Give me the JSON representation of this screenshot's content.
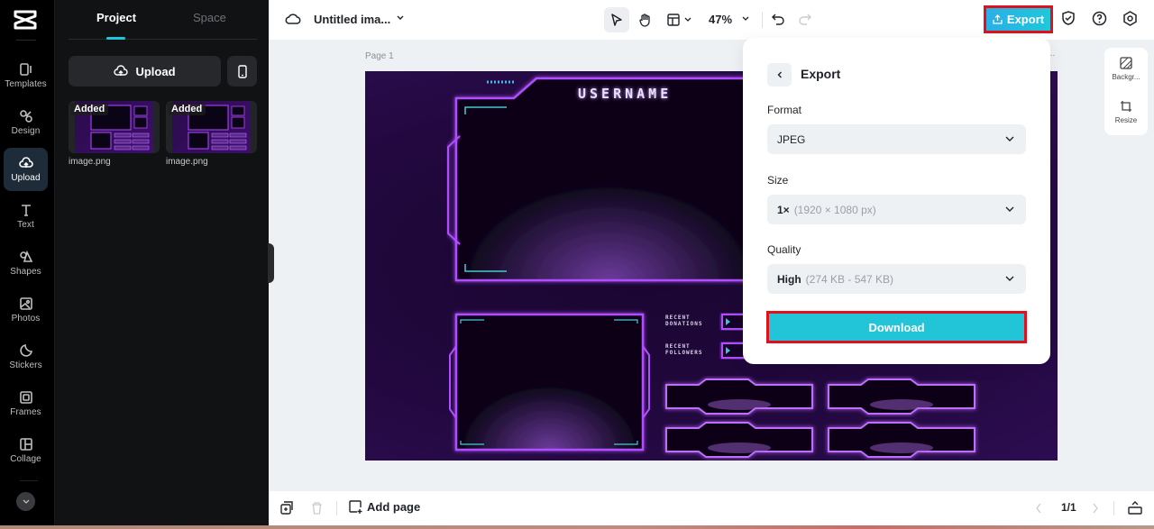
{
  "rail": {
    "items": [
      {
        "label": "Templates",
        "icon": "templates-icon"
      },
      {
        "label": "Design",
        "icon": "design-icon"
      },
      {
        "label": "Upload",
        "icon": "cloud-upload-icon",
        "active": true
      },
      {
        "label": "Text",
        "icon": "text-icon"
      },
      {
        "label": "Shapes",
        "icon": "shapes-icon"
      },
      {
        "label": "Photos",
        "icon": "photo-icon"
      },
      {
        "label": "Stickers",
        "icon": "sticker-icon"
      },
      {
        "label": "Frames",
        "icon": "frame-icon"
      },
      {
        "label": "Collage",
        "icon": "collage-icon"
      }
    ]
  },
  "panel": {
    "tabs": [
      {
        "label": "Project",
        "active": true
      },
      {
        "label": "Space",
        "active": false
      }
    ],
    "upload_label": "Upload",
    "files": [
      {
        "badge": "Added",
        "name": "image.png"
      },
      {
        "badge": "Added",
        "name": "image.png"
      }
    ]
  },
  "topbar": {
    "title": "Untitled ima...",
    "zoom": "47%",
    "export_label": "Export"
  },
  "canvas": {
    "page_label": "Page 1",
    "page_more": "...",
    "artwork": {
      "username": "USERNAME",
      "recent_donations": [
        "RECENT",
        "DONATIONS"
      ],
      "recent_followers": [
        "RECENT",
        "FOLLOWERS"
      ]
    }
  },
  "side_tools": [
    {
      "label": "Backgr...",
      "icon": "background-icon"
    },
    {
      "label": "Resize",
      "icon": "resize-icon"
    }
  ],
  "export_panel": {
    "title": "Export",
    "format": {
      "label": "Format",
      "value": "JPEG"
    },
    "size": {
      "label": "Size",
      "value": "1×",
      "detail": "(1920 × 1080 px)"
    },
    "quality": {
      "label": "Quality",
      "value": "High",
      "detail": "(274 KB - 547 KB)"
    },
    "download_label": "Download"
  },
  "bottombar": {
    "add_page_label": "Add page",
    "pager": "1/1"
  },
  "colors": {
    "accent": "#22c4d8",
    "highlight_border": "#e0111d",
    "neon_purple": "#b04dff"
  }
}
